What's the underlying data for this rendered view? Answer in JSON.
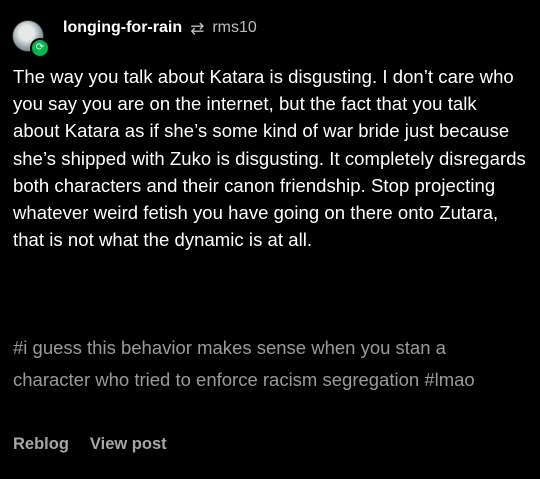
{
  "post": {
    "username": "longing-for-rain",
    "reblog_icon": "reblog-icon",
    "source_username": "rms10",
    "body_text": "The way you talk about Katara is disgusting. I don’t care who you say you are on the internet, but the fact that you talk about Katara as if she’s some kind of war bride just because she’s shipped with Zuko is disgusting. It completely disregards both characters and their canon friendship. Stop projecting whatever weird fetish you have going on there onto Zutara, that is not what the dynamic is at all.",
    "tags": [
      "#i guess this behavior makes sense when you stan a character who tried to enforce racism segregation",
      "#lmao"
    ]
  },
  "footer": {
    "reblog_label": "Reblog",
    "view_post_label": "View post"
  },
  "colors": {
    "background": "#000000",
    "text": "#ffffff",
    "muted": "#9a9a9a",
    "reblog_badge": "#00b84d"
  }
}
